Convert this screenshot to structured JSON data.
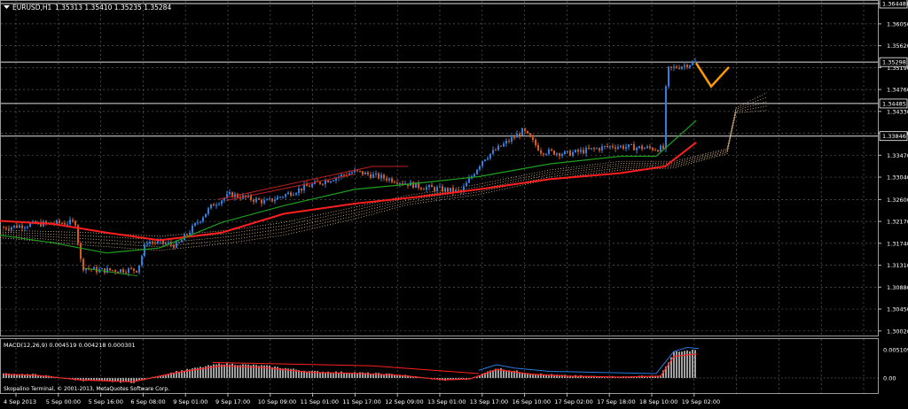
{
  "header": {
    "symbol_label": "EURUSD,H1",
    "ohlc": "1.35313 1.35410 1.35235 1.35284",
    "menu_arrow": "triangle-down-icon"
  },
  "price_axis": {
    "ticks": [
      "1.36448",
      "1.36050",
      "1.35620",
      "1.35190",
      "1.34760",
      "1.34330",
      "1.33900",
      "1.33470",
      "1.33040",
      "1.32600",
      "1.32170",
      "1.31740",
      "1.31310",
      "1.30880",
      "1.30450",
      "1.30020"
    ],
    "price_labels": [
      {
        "value": "1.36448",
        "boxed": true
      },
      {
        "value": "1.35298",
        "boxed": true
      },
      {
        "value": "1.34485",
        "boxed": true
      },
      {
        "value": "1.33846",
        "boxed": true
      }
    ]
  },
  "macd": {
    "label": "MACD(12,26,9) 0.004519 0.004218 0.000301",
    "ticks": [
      "0.005109",
      "0.00"
    ]
  },
  "time_axis": {
    "labels": [
      "4 Sep 2013",
      "5 Sep 00:00",
      "5 Sep 16:00",
      "6 Sep 08:00",
      "9 Sep 01:00",
      "9 Sep 17:00",
      "10 Sep 09:00",
      "11 Sep 01:00",
      "11 Sep 17:00",
      "12 Sep 09:00",
      "13 Sep 01:00",
      "13 Sep 17:00",
      "16 Sep 10:00",
      "17 Sep 02:00",
      "17 Sep 18:00",
      "18 Sep 10:00",
      "19 Sep 02:00"
    ]
  },
  "footer": {
    "copyright": "Skopalino Terminal, © 2001-2013, MetaQuotes Software Corp."
  },
  "colors": {
    "background": "#000000",
    "grid": "#5a5a5a",
    "bull_candle": "#2f7fe0",
    "bear_candle": "#d75a1a",
    "ma_red": "#ff1e1e",
    "ma_green": "#1ea01e",
    "cloud": "#e8c090",
    "zigzag": "#ff9900",
    "macd_hist": "#c8c8c8",
    "macd_signal": "#ff2020",
    "macd_main": "#2a7ae0"
  }
}
